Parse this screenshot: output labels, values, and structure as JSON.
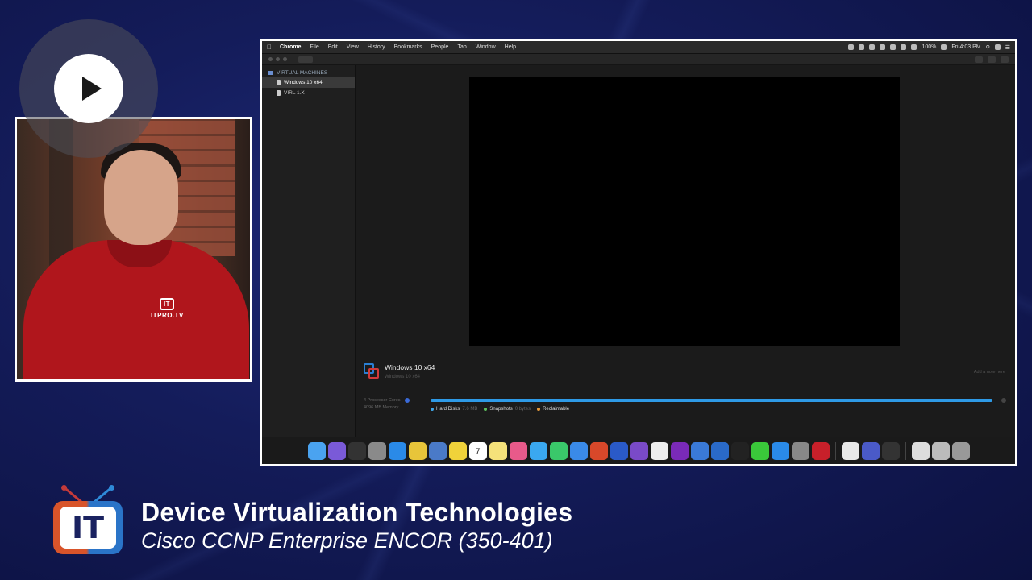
{
  "menubar": {
    "app": "Chrome",
    "items": [
      "File",
      "Edit",
      "View",
      "History",
      "Bookmarks",
      "People",
      "Tab",
      "Window",
      "Help"
    ],
    "battery": "100%",
    "clock": "Fri 4:03 PM"
  },
  "sidebar": {
    "section": "VIRTUAL MACHINES",
    "items": [
      {
        "label": "Windows 10 x64",
        "selected": true
      },
      {
        "label": "VIRL 1.X",
        "selected": false
      }
    ]
  },
  "vm": {
    "name": "Windows 10 x64",
    "subtitle": "Windows 10 x64",
    "add_note": "Add a note here",
    "cores": "4 Processor Cores",
    "memory": "4096 MB Memory",
    "storage_used_fraction": 0.99,
    "legend": {
      "hard_disks": "Hard Disks",
      "hard_disks_size": "7.6 MB",
      "snapshots": "Snapshots",
      "snapshots_size": "0 bytes",
      "reclaimable": "Reclaimable"
    }
  },
  "colors": {
    "accent_blue": "#2e9ae6",
    "legend_hard_disks": "#3ea6e8",
    "legend_snapshots": "#5cc05c",
    "legend_reclaimable": "#e89a3a",
    "shirt_red": "#b0161c"
  },
  "presenter": {
    "shirt_logo": "ITPRO.TV",
    "shirt_logo_mark": "IT"
  },
  "lower_third": {
    "logo_text": "IT",
    "title": "Device Virtualization Technologies",
    "subtitle": "Cisco CCNP Enterprise ENCOR (350-401)"
  },
  "dock": {
    "icons": [
      "finder-icon",
      "siri-icon",
      "mission-control-icon",
      "launchpad-icon",
      "safari-icon",
      "chrome-icon",
      "preview-icon",
      "notes-icon",
      "calendar-icon",
      "stickies-icon",
      "photos-icon",
      "messages-icon",
      "numbers-icon",
      "keynote-icon",
      "powerpoint-icon",
      "word-icon",
      "omnifocus-icon",
      "textedit-icon",
      "onenote-icon",
      "vmware-fusion-icon",
      "packet-tracer-icon",
      "terminal-icon",
      "camtasia-icon",
      "app-store-icon",
      "system-preferences-icon",
      "quicken-icon",
      "itunes-icon",
      "teams-icon",
      "logitech-icon",
      "scanner-icon",
      "downloads-icon",
      "trash-icon"
    ],
    "calendar_day": "7"
  }
}
